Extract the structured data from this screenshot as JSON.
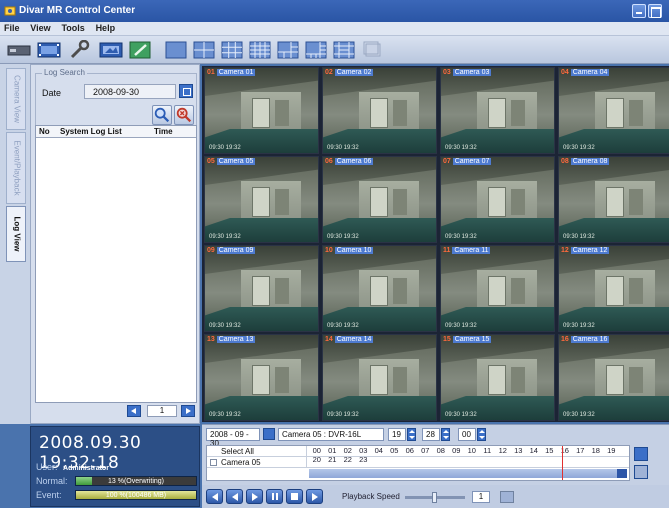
{
  "window": {
    "title": "Divar MR Control Center"
  },
  "menu": [
    "File",
    "View",
    "Tools",
    "Help"
  ],
  "side_tabs": [
    "Camera View",
    "Event/Playback",
    "Log View"
  ],
  "log_search": {
    "legend": "Log Search",
    "date_label": "Date",
    "date_value": "2008-09-30",
    "columns": [
      "No",
      "System Log List",
      "Time"
    ],
    "page": "1"
  },
  "status": {
    "clock": "2008.09.30  19:32:18",
    "user_label": "User:",
    "user_value": "Administrator",
    "normal_label": "Normal:",
    "normal_text": "13 %(Overwriting)",
    "normal_fill": 0.13,
    "event_label": "Event:",
    "event_text": "100 %(100486 MB)",
    "event_fill": 1.0
  },
  "cameras": [
    {
      "no": "01",
      "name": "Camera 01",
      "stamp": "09:30 19:32"
    },
    {
      "no": "02",
      "name": "Camera 02",
      "stamp": "09:30 19:32"
    },
    {
      "no": "03",
      "name": "Camera 03",
      "stamp": "09:30 19:32"
    },
    {
      "no": "04",
      "name": "Camera 04",
      "stamp": "09:30 19:32"
    },
    {
      "no": "05",
      "name": "Camera 05",
      "stamp": "09:30 19:32"
    },
    {
      "no": "06",
      "name": "Camera 06",
      "stamp": "09:30 19:32"
    },
    {
      "no": "07",
      "name": "Camera 07",
      "stamp": "09:30 19:32"
    },
    {
      "no": "08",
      "name": "Camera 08",
      "stamp": "09:30 19:32"
    },
    {
      "no": "09",
      "name": "Camera 09",
      "stamp": "09:30 19:32"
    },
    {
      "no": "10",
      "name": "Camera 10",
      "stamp": "09:30 19:32"
    },
    {
      "no": "11",
      "name": "Camera 11",
      "stamp": "09:30 19:32"
    },
    {
      "no": "12",
      "name": "Camera 12",
      "stamp": "09:30 19:32"
    },
    {
      "no": "13",
      "name": "Camera 13",
      "stamp": "09:30 19:32"
    },
    {
      "no": "14",
      "name": "Camera 14",
      "stamp": "09:30 19:32"
    },
    {
      "no": "15",
      "name": "Camera 15",
      "stamp": "09:30 19:32"
    },
    {
      "no": "16",
      "name": "Camera 16",
      "stamp": "09:30 19:32"
    }
  ],
  "playback": {
    "date": "2008 - 09 - 30",
    "camera": "Camera 05 : DVR-16L",
    "hour": "19",
    "minute": "28",
    "second": "00",
    "select_all": "Select All",
    "track_camera": "Camera 05",
    "hours": [
      "00",
      "01",
      "02",
      "03",
      "04",
      "05",
      "06",
      "07",
      "08",
      "09",
      "10",
      "11",
      "12",
      "13",
      "14",
      "15",
      "16",
      "17",
      "18",
      "19",
      "20",
      "21",
      "22",
      "23"
    ],
    "speed_label": "Playback Speed",
    "speed_value": "1",
    "speed_level": 0.5
  }
}
